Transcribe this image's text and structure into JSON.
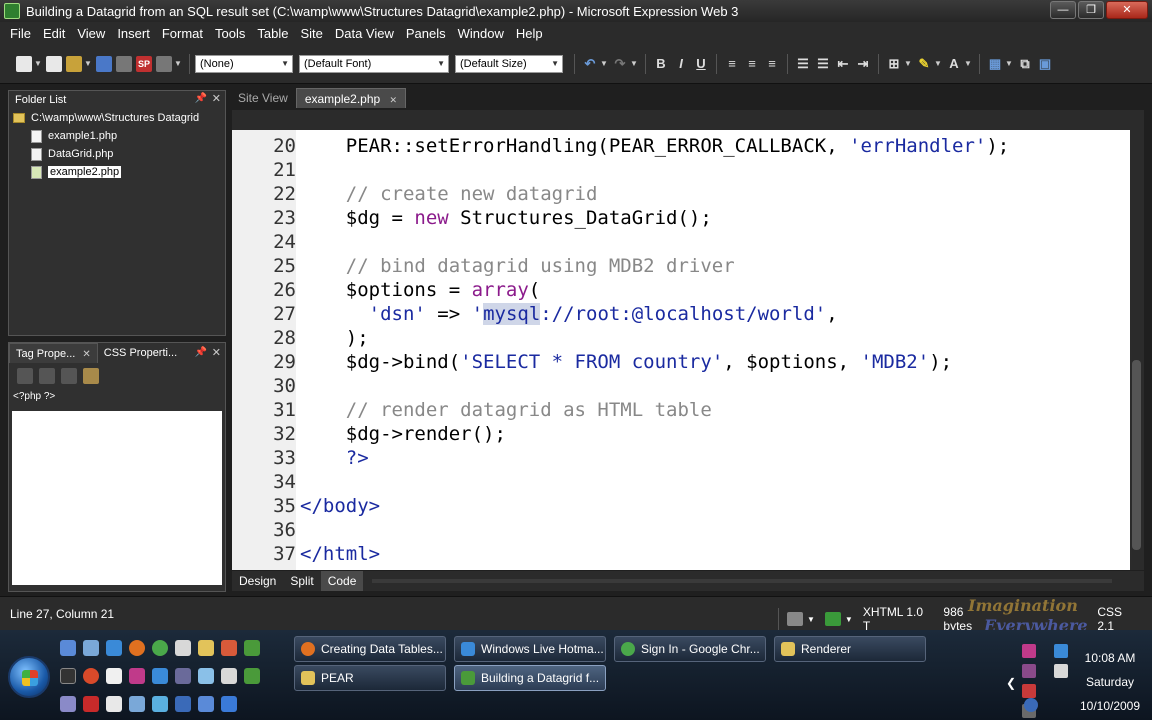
{
  "window": {
    "title": "Building a Datagrid from an SQL result set (C:\\wamp\\www\\Structures Datagrid\\example2.php) - Microsoft Expression Web 3",
    "minimize": "—",
    "maximize": "❐",
    "close": "✕"
  },
  "menu": {
    "items": [
      "File",
      "Edit",
      "View",
      "Insert",
      "Format",
      "Tools",
      "Table",
      "Site",
      "Data View",
      "Panels",
      "Window",
      "Help"
    ]
  },
  "toolbar": {
    "style_select": "(None)",
    "font_select": "(Default Font)",
    "size_select": "(Default Size)",
    "sp_label": "SP",
    "bold": "B",
    "italic": "I",
    "underline": "U"
  },
  "folder_list": {
    "title": "Folder List",
    "root": "C:\\wamp\\www\\Structures Datagrid",
    "files": [
      "example1.php",
      "DataGrid.php",
      "example2.php"
    ],
    "selected": "example2.php"
  },
  "tag_panel": {
    "tab1": "Tag Prope...",
    "tab2": "CSS Properti...",
    "current_tag": "<?php ?>"
  },
  "editor": {
    "tabs": [
      "Site View",
      "example2.php"
    ],
    "active_tab": "example2.php",
    "lines": [
      {
        "n": "20",
        "segments": [
          {
            "t": "    PEAR::setErrorHandling(PEAR_ERROR_CALLBACK, ",
            "c": ""
          },
          {
            "t": "'errHandler'",
            "c": "str"
          },
          {
            "t": ");",
            "c": ""
          }
        ]
      },
      {
        "n": "21",
        "segments": []
      },
      {
        "n": "22",
        "segments": [
          {
            "t": "    // create new datagrid",
            "c": "comment"
          }
        ]
      },
      {
        "n": "23",
        "segments": [
          {
            "t": "    $dg = ",
            "c": ""
          },
          {
            "t": "new",
            "c": "kw"
          },
          {
            "t": " Structures_DataGrid();",
            "c": ""
          }
        ]
      },
      {
        "n": "24",
        "segments": []
      },
      {
        "n": "25",
        "segments": [
          {
            "t": "    // bind datagrid using MDB2 driver",
            "c": "comment"
          }
        ]
      },
      {
        "n": "26",
        "segments": [
          {
            "t": "    $options = ",
            "c": ""
          },
          {
            "t": "array",
            "c": "kw"
          },
          {
            "t": "(",
            "c": ""
          }
        ]
      },
      {
        "n": "27",
        "segments": [
          {
            "t": "      ",
            "c": ""
          },
          {
            "t": "'dsn'",
            "c": "str"
          },
          {
            "t": " => ",
            "c": ""
          },
          {
            "t": "'",
            "c": "str"
          },
          {
            "t": "mysql",
            "c": "hl"
          },
          {
            "t": "://root:@localhost/world'",
            "c": "str"
          },
          {
            "t": ",",
            "c": ""
          }
        ]
      },
      {
        "n": "28",
        "segments": [
          {
            "t": "    );",
            "c": ""
          }
        ]
      },
      {
        "n": "29",
        "segments": [
          {
            "t": "    $dg->bind(",
            "c": ""
          },
          {
            "t": "'SELECT * FROM country'",
            "c": "str"
          },
          {
            "t": ", $options, ",
            "c": ""
          },
          {
            "t": "'MDB2'",
            "c": "str"
          },
          {
            "t": ");",
            "c": ""
          }
        ]
      },
      {
        "n": "30",
        "segments": []
      },
      {
        "n": "31",
        "segments": [
          {
            "t": "    // render datagrid as HTML table",
            "c": "comment"
          }
        ]
      },
      {
        "n": "32",
        "segments": [
          {
            "t": "    $dg->render();",
            "c": ""
          }
        ]
      },
      {
        "n": "33",
        "segments": [
          {
            "t": "    ?>",
            "c": "tag"
          }
        ]
      },
      {
        "n": "34",
        "segments": []
      },
      {
        "n": "35",
        "segments": [
          {
            "t": "</body>",
            "c": "tag"
          }
        ]
      },
      {
        "n": "36",
        "segments": []
      },
      {
        "n": "37",
        "segments": [
          {
            "t": "</html>",
            "c": "tag"
          }
        ]
      }
    ]
  },
  "view_tabs": [
    "Design",
    "Split",
    "Code"
  ],
  "active_view": "Code",
  "status": {
    "position": "Line 27, Column 21",
    "doctype": "XHTML 1.0 T",
    "size": "986 bytes",
    "css": "CSS 2.1"
  },
  "watermark": {
    "line1": "Imagination",
    "line2": "Everywhere"
  },
  "taskbar": {
    "row1": [
      {
        "label": "Creating Data Tables...",
        "icon_color": "#e07020"
      },
      {
        "label": "Windows Live Hotma...",
        "icon_color": "#3a8ad8"
      },
      {
        "label": "Sign In - Google Chr...",
        "icon_color": "#4aa84a"
      },
      {
        "label": "Renderer",
        "icon_color": "#e2c35a"
      }
    ],
    "row2": [
      {
        "label": "PEAR",
        "icon_color": "#e2c35a"
      },
      {
        "label": "Building a Datagrid f...",
        "icon_color": "#4a9a3a"
      }
    ]
  },
  "clock": {
    "time": "10:08 AM",
    "day": "Saturday",
    "date": "10/10/2009"
  }
}
